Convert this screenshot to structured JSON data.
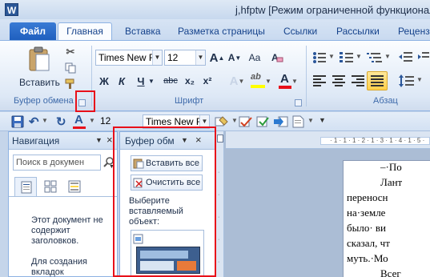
{
  "window": {
    "app_icon": "W",
    "title": "j,hfptw [Режим ограниченной функциональ"
  },
  "tabs": [
    {
      "label": "Файл"
    },
    {
      "label": "Главная"
    },
    {
      "label": "Вставка"
    },
    {
      "label": "Разметка страницы"
    },
    {
      "label": "Ссылки"
    },
    {
      "label": "Рассылки"
    },
    {
      "label": "Рецензи"
    }
  ],
  "ribbon": {
    "clipboard": {
      "label": "Буфер обмена",
      "paste_label": "Вставить"
    },
    "font": {
      "label": "Шрифт",
      "font_name": "Times New Rc",
      "font_size": "12",
      "bold": "Ж",
      "italic": "К",
      "underline": "Ч",
      "strike": "abc",
      "subscript": "x₂",
      "superscript": "x²",
      "grow": "A",
      "shrink": "A",
      "case": "Aa",
      "font_color": "A",
      "highlight": "ab"
    },
    "paragraph": {
      "label": "Абзац"
    }
  },
  "qat": {
    "font_size": "12",
    "font_name": "Times New Rc"
  },
  "navigation": {
    "title": "Навигация",
    "search_placeholder": "Поиск в докумен",
    "message1": "Этот документ не содержит заголовков.",
    "message2": "Для создания вкладок"
  },
  "clipboard_pane": {
    "title": "Буфер обм",
    "paste_all": "Вставить все",
    "clear_all": "Очистить все",
    "instruction": "Выберите вставляемый объект:"
  },
  "ruler": {
    "marks": "· 1 · 1 · 1 · 2 · 1 · 3 · 1 · 4 · 1 · 5 ·"
  },
  "document": {
    "lines": [
      "–·По",
      "Лант",
      "переносн",
      "на·земле",
      "было· ви",
      "сказал, чт",
      "муть.·Мо",
      "Всег"
    ]
  },
  "colors": {
    "accent": "#2b579a",
    "highlight_red": "#e8101a",
    "font_color_bar": "#e8101a",
    "highlight_bar": "#ffff00"
  }
}
